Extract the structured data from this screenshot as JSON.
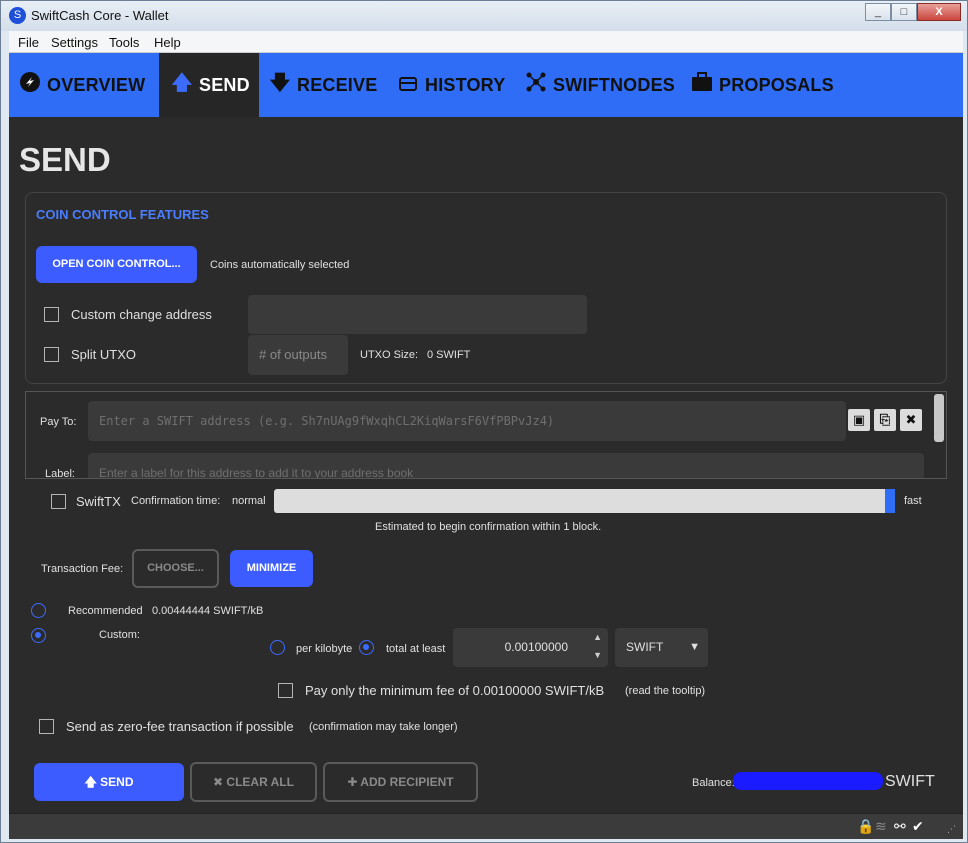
{
  "window": {
    "title": "SwiftCash Core - Wallet",
    "buttons": [
      "_",
      "□",
      "X"
    ]
  },
  "menu": [
    "File",
    "Settings",
    "Tools",
    "Help"
  ],
  "tabs": [
    {
      "label": "OVERVIEW",
      "icon": "logo-icon"
    },
    {
      "label": "SEND",
      "icon": "arrow-up-icon"
    },
    {
      "label": "RECEIVE",
      "icon": "arrow-down-icon"
    },
    {
      "label": "HISTORY",
      "icon": "history-icon"
    },
    {
      "label": "SWIFTNODES",
      "icon": "nodes-icon"
    },
    {
      "label": "PROPOSALS",
      "icon": "briefcase-icon"
    }
  ],
  "page_title": "SEND",
  "coin_control": {
    "title": "COIN CONTROL FEATURES",
    "open_button": "OPEN COIN CONTROL...",
    "status": "Coins automatically selected",
    "custom_change_label": "Custom change address",
    "split_utxo_label": "Split UTXO",
    "outputs_placeholder": "# of outputs",
    "utxo_size_label": "UTXO Size:",
    "utxo_size_value": "0 SWIFT"
  },
  "recipient": {
    "pay_to_label": "Pay To:",
    "pay_to_placeholder": "Enter a SWIFT address (e.g. Sh7nUAg9fWxqhCL2KiqWarsF6VfPBPvJz4)",
    "label_label": "Label:",
    "label_placeholder": "Enter a label for this address to add it to your address book"
  },
  "swifttx": {
    "label": "SwiftTX",
    "confirmation_label": "Confirmation time:",
    "normal": "normal",
    "fast": "fast",
    "estimate": "Estimated to begin confirmation within 1 block.",
    "slider_level": 1.0
  },
  "fee": {
    "label": "Transaction Fee:",
    "choose_button": "CHOOSE...",
    "minimize_button": "MINIMIZE",
    "recommended_label": "Recommended",
    "recommended_value": "0.00444444 SWIFT/kB",
    "custom_label": "Custom:",
    "per_kilobyte": "per kilobyte",
    "total_at_least": "total at least",
    "amount": "0.00100000",
    "unit": "SWIFT",
    "min_fee_label": "Pay only the minimum fee of 0.00100000 SWIFT/kB",
    "tooltip_note": "(read the tooltip)",
    "zero_fee_label": "Send as zero-fee transaction if possible",
    "zero_fee_note": "(confirmation may take longer)"
  },
  "actions": {
    "send": "SEND",
    "clear_all": "CLEAR ALL",
    "add_recipient": "ADD RECIPIENT"
  },
  "balance": {
    "label": "Balance:",
    "unit_suffix": "SWIFT"
  },
  "colors": {
    "accent": "#2f6df6",
    "button": "#3c5cff",
    "panel": "#2b2b2b"
  }
}
